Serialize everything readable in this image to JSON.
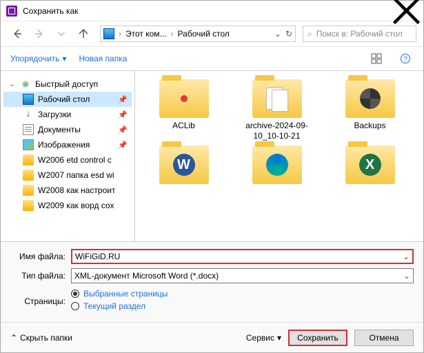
{
  "title": "Сохранить как",
  "breadcrumb": {
    "root": "Этот ком...",
    "current": "Рабочий стол"
  },
  "search": {
    "placeholder": "Поиск в: Рабочий стол"
  },
  "toolbar": {
    "organize": "Упорядочить",
    "newfolder": "Новая папка"
  },
  "tree": {
    "quick": "Быстрый доступ",
    "desktop": "Рабочий стол",
    "downloads": "Загрузки",
    "documents": "Документы",
    "pictures": "Изображения",
    "f1": "W2006 etd control c",
    "f2": "W2007 папка esd wi",
    "f3": "W2008 как настроит",
    "f4": "W2009 как ворд сох"
  },
  "files": [
    {
      "label": "ACLib",
      "ov": "dot"
    },
    {
      "label": "archive-2024-09-10_10-10-21",
      "ov": "stack"
    },
    {
      "label": "Backups",
      "ov": "disk"
    },
    {
      "label": "",
      "ov": "word",
      "glyph": "W"
    },
    {
      "label": "",
      "ov": "edge",
      "glyph": ""
    },
    {
      "label": "",
      "ov": "excel",
      "glyph": "X"
    }
  ],
  "form": {
    "filename_label": "Имя файла:",
    "filename_value": "WiFiGiD.RU",
    "filetype_label": "Тип файла:",
    "filetype_value": "XML-документ Microsoft Word (*.docx)",
    "pages_label": "Страницы:",
    "opt_selected": "Выбранные страницы",
    "opt_current": "Текущий раздел"
  },
  "footer": {
    "collapse": "Скрыть папки",
    "service": "Сервис",
    "save": "Сохранить",
    "cancel": "Отмена"
  }
}
